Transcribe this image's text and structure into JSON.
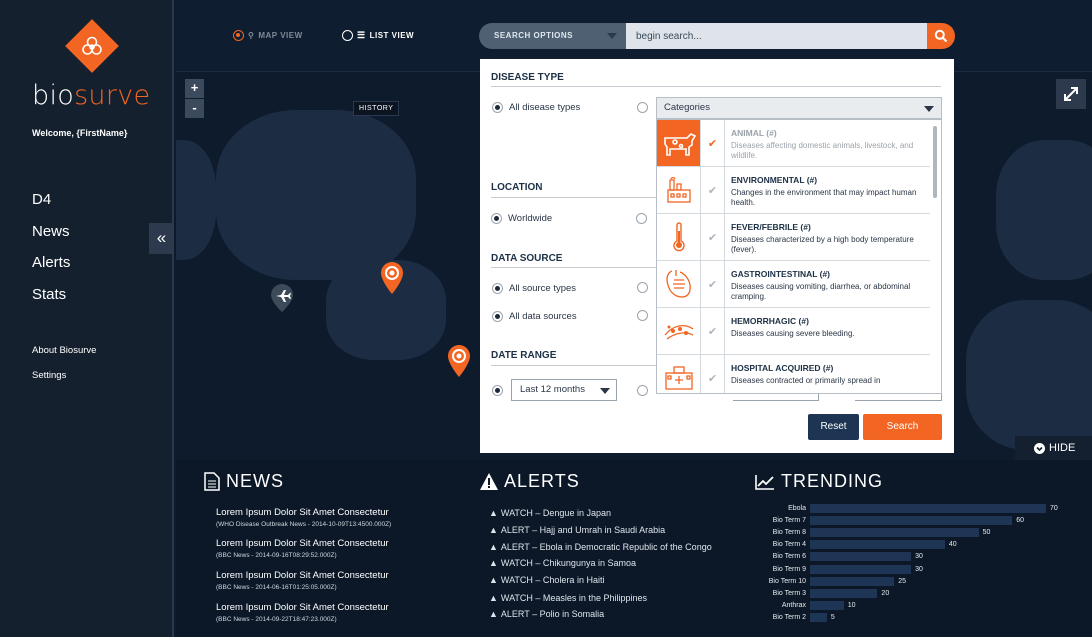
{
  "sidebar": {
    "brand_part1": "bio",
    "brand_part2": "surve",
    "welcome": "Welcome, {FirstName}",
    "nav": [
      "D4",
      "News",
      "Alerts",
      "Stats"
    ],
    "nav2": [
      "About Biosurve",
      "Settings"
    ],
    "collapse_icon": "«"
  },
  "topbar": {
    "map_view": "MAP VIEW",
    "list_view": "LIST VIEW",
    "search_options": "SEARCH OPTIONS",
    "search_placeholder": "begin search..."
  },
  "map": {
    "history": "HISTORY",
    "zoom_in": "+",
    "zoom_out": "-"
  },
  "hide": "HIDE",
  "modal": {
    "disease_type": "DISEASE TYPE",
    "all_disease_types": "All disease types",
    "categories_placeholder": "Categories",
    "location": "LOCATION",
    "worldwide": "Worldwide",
    "data_source": "DATA SOURCE",
    "all_source_types": "All source types",
    "all_data_sources": "All data sources",
    "date_range": "DATE RANGE",
    "date_value": "Last 12 months",
    "reset": "Reset",
    "search": "Search",
    "categories": [
      {
        "title": "ANIMAL (#)",
        "desc": "Diseases affecting domestic animals, livestock, and wildlife.",
        "icon": "cow-icon",
        "selected": true
      },
      {
        "title": "ENVIRONMENTAL (#)",
        "desc": "Changes in the environment that may impact human health.",
        "icon": "factory-icon",
        "selected": false
      },
      {
        "title": "FEVER/FEBRILE (#)",
        "desc": "Diseases characterized by a high body temperature (fever).",
        "icon": "thermometer-icon",
        "selected": false
      },
      {
        "title": "GASTROINTESTINAL (#)",
        "desc": "Diseases causing vomiting, diarrhea, or abdominal cramping.",
        "icon": "intestine-icon",
        "selected": false
      },
      {
        "title": "HEMORRHAGIC (#)",
        "desc": "Diseases causing severe bleeding.",
        "icon": "blood-cells-icon",
        "selected": false
      },
      {
        "title": "HOSPITAL ACQUIRED (#)",
        "desc": "Diseases contracted or primarily spread in",
        "icon": "hospital-icon",
        "selected": false
      }
    ]
  },
  "news": {
    "title": "NEWS",
    "items": [
      {
        "title": "Lorem Ipsum Dolor Sit Amet Consectetur",
        "sub": "(WHO Disease Outbreak News - 2014-10-09T13:4500.000Z)"
      },
      {
        "title": "Lorem Ipsum Dolor Sit Amet Consectetur",
        "sub": "(BBC News - 2014-09-16T08:29:52.000Z)"
      },
      {
        "title": "Lorem Ipsum Dolor Sit Amet Consectetur",
        "sub": "(BBC News - 2014-06-16T01:25:05.000Z)"
      },
      {
        "title": "Lorem Ipsum Dolor Sit Amet Consectetur",
        "sub": "(BBC News - 2014-09-22T18:47:23.000Z)"
      }
    ]
  },
  "alerts": {
    "title": "ALERTS",
    "items": [
      "WATCH – Dengue in Japan",
      "ALERT – Hajj and Umrah in Saudi Arabia",
      "ALERT – Ebola in Democratic Republic of the Congo",
      "WATCH – Chikungunya in Samoa",
      "WATCH – Cholera in Haiti",
      "WATCH – Measles in the Philippines",
      "ALERT – Polio in Somalia"
    ]
  },
  "trending": {
    "title": "TRENDING",
    "chart_data": {
      "type": "bar",
      "categories": [
        "Ebola",
        "Bio Term 7",
        "Bio Term 8",
        "Bio Term 4",
        "Bio Term 6",
        "Bio Term 9",
        "Bio Term 10",
        "Bio Term 3",
        "Anthrax",
        "Bio Term 2"
      ],
      "values": [
        70,
        60,
        50,
        40,
        30,
        30,
        25,
        20,
        10,
        5
      ]
    }
  },
  "colors": {
    "accent": "#f26522",
    "navy": "#1d3553"
  }
}
